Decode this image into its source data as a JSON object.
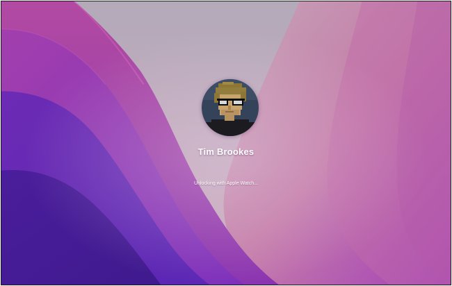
{
  "login": {
    "user_name": "Tim Brookes",
    "status": "Unlocking with Apple Watch..."
  },
  "avatar": {
    "icon": "pixel-art-avatar-icon",
    "description_colors": {
      "hair": "#8f7a3a",
      "skin": "#c8a46e",
      "glasses": "#0a0a0a",
      "shirt": "#1a1a1e",
      "background": "#3a4a62"
    }
  },
  "colors": {
    "wallpaper_top": "#b2a6be",
    "wallpaper_magenta": "#b14aa6",
    "wallpaper_violet": "#6a2fb8",
    "wallpaper_indigo": "#4a1e9e",
    "text": "#ffffff"
  }
}
